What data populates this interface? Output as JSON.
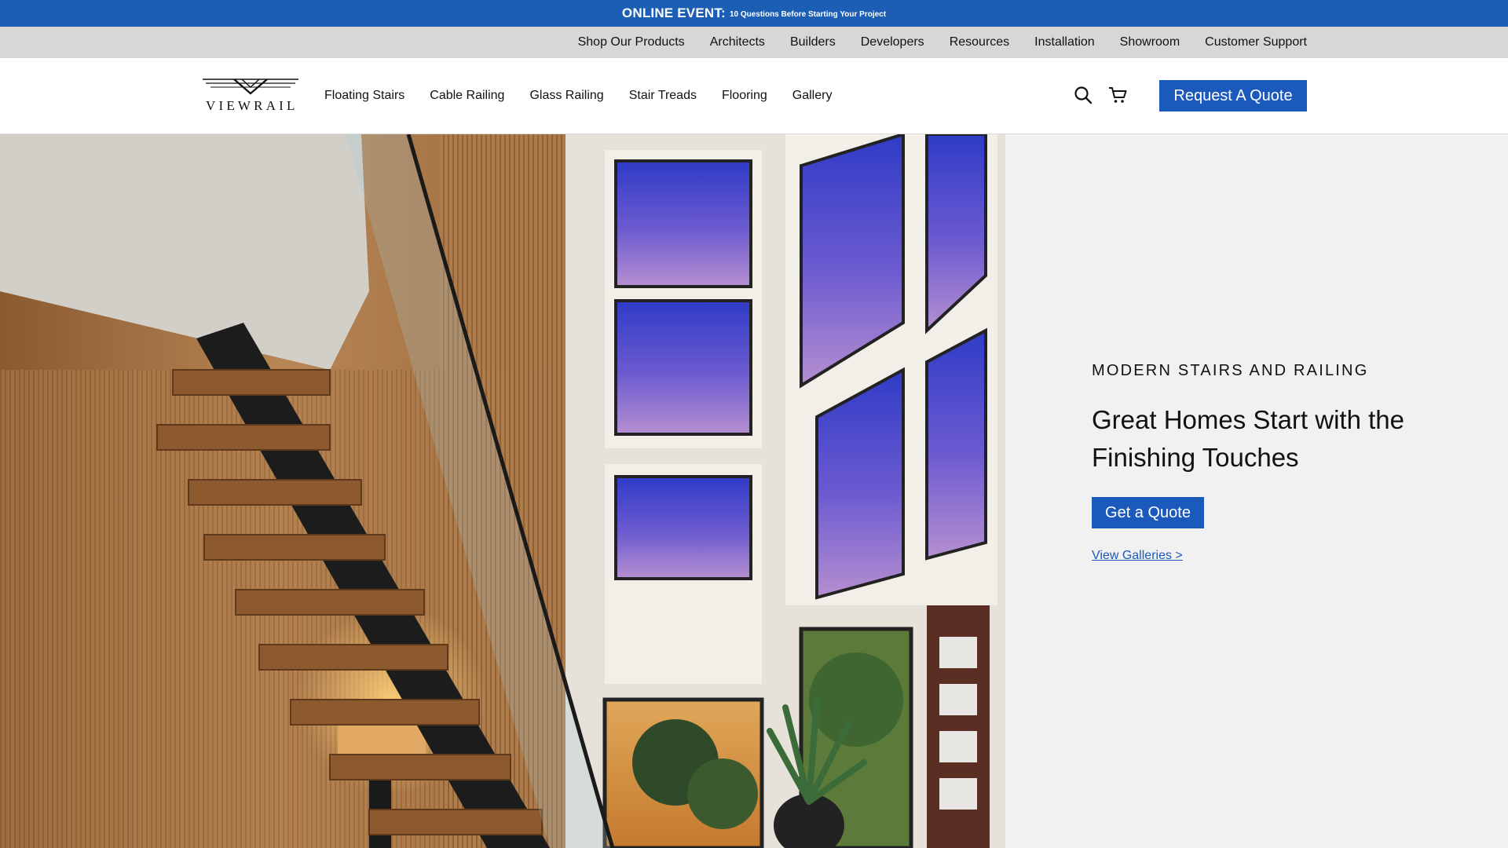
{
  "announcement": {
    "label": "ONLINE EVENT:",
    "text": "10 Questions Before Starting Your Project"
  },
  "subnav": {
    "items": [
      "Shop Our Products",
      "Architects",
      "Builders",
      "Developers",
      "Resources",
      "Installation",
      "Showroom",
      "Customer Support"
    ]
  },
  "header": {
    "logo_text": "VIEWRAIL",
    "nav": [
      "Floating Stairs",
      "Cable Railing",
      "Glass Railing",
      "Stair Treads",
      "Flooring",
      "Gallery"
    ],
    "icons": {
      "search": "search-icon",
      "cart": "cart-icon"
    },
    "quote_button": "Request A Quote"
  },
  "hero": {
    "eyebrow": "MODERN STAIRS AND RAILING",
    "headline": "Great Homes Start with the Finishing Touches",
    "cta": "Get a Quote",
    "link": "View Galleries >"
  },
  "colors": {
    "brand_blue": "#1c59bd",
    "announcement_bg": "#1b5eb4",
    "subnav_bg": "#d7d7d7"
  }
}
